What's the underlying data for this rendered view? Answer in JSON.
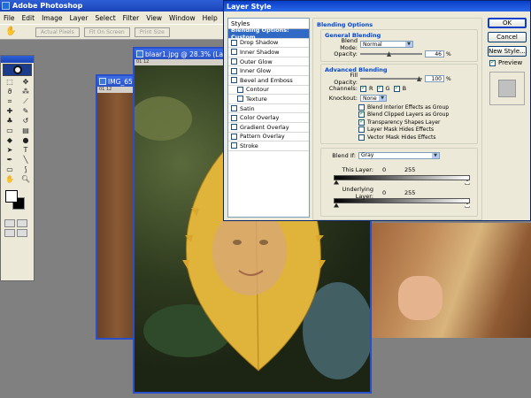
{
  "app": {
    "title": "Adobe Photoshop"
  },
  "menu": [
    "File",
    "Edit",
    "Image",
    "Layer",
    "Select",
    "Filter",
    "View",
    "Window",
    "Help"
  ],
  "options_bar": {
    "buttons": [
      "Actual Pixels",
      "Fit On Screen",
      "Print Size"
    ]
  },
  "documents": {
    "main": {
      "title": "blaar1.jpg @ 28.3% (La",
      "ruler": "01 12"
    },
    "back": {
      "title": "IMG_65",
      "ruler": "01 12"
    }
  },
  "dialog": {
    "title": "Layer Style",
    "styles_header": "Styles",
    "styles": [
      {
        "label": "Blending Options: Custom",
        "selected": true,
        "checkbox": false
      },
      {
        "label": "Drop Shadow",
        "checkbox": true
      },
      {
        "label": "Inner Shadow",
        "checkbox": true
      },
      {
        "label": "Outer Glow",
        "checkbox": true
      },
      {
        "label": "Inner Glow",
        "checkbox": true
      },
      {
        "label": "Bevel and Emboss",
        "checkbox": true
      },
      {
        "label": "Contour",
        "checkbox": true,
        "indent": true
      },
      {
        "label": "Texture",
        "checkbox": true,
        "indent": true
      },
      {
        "label": "Satin",
        "checkbox": true
      },
      {
        "label": "Color Overlay",
        "checkbox": true
      },
      {
        "label": "Gradient Overlay",
        "checkbox": true
      },
      {
        "label": "Pattern Overlay",
        "checkbox": true
      },
      {
        "label": "Stroke",
        "checkbox": true
      }
    ],
    "blending_options": {
      "title": "Blending Options",
      "general": {
        "title": "General Blending",
        "blend_mode_label": "Blend Mode:",
        "blend_mode_value": "Normal",
        "opacity_label": "Opacity:",
        "opacity_value": "46",
        "opacity_unit": "%"
      },
      "advanced": {
        "title": "Advanced Blending",
        "fill_opacity_label": "Fill Opacity:",
        "fill_opacity_value": "100",
        "fill_unit": "%",
        "channels_label": "Channels:",
        "channels": [
          "R",
          "G",
          "B"
        ],
        "knockout_label": "Knockout:",
        "knockout_value": "None",
        "checks": [
          {
            "label": "Blend Interior Effects as Group",
            "checked": false
          },
          {
            "label": "Blend Clipped Layers as Group",
            "checked": true
          },
          {
            "label": "Transparency Shapes Layer",
            "checked": true
          },
          {
            "label": "Layer Mask Hides Effects",
            "checked": false
          },
          {
            "label": "Vector Mask Hides Effects",
            "checked": false
          }
        ]
      },
      "blend_if": {
        "label": "Blend If:",
        "value": "Gray",
        "this_layer_label": "This Layer:",
        "this_layer_low": "0",
        "this_layer_high": "255",
        "underlying_label": "Underlying Layer:",
        "underlying_low": "0",
        "underlying_high": "255"
      }
    },
    "buttons": {
      "ok": "OK",
      "cancel": "Cancel",
      "new_style": "New Style..."
    },
    "preview_label": "Preview"
  }
}
